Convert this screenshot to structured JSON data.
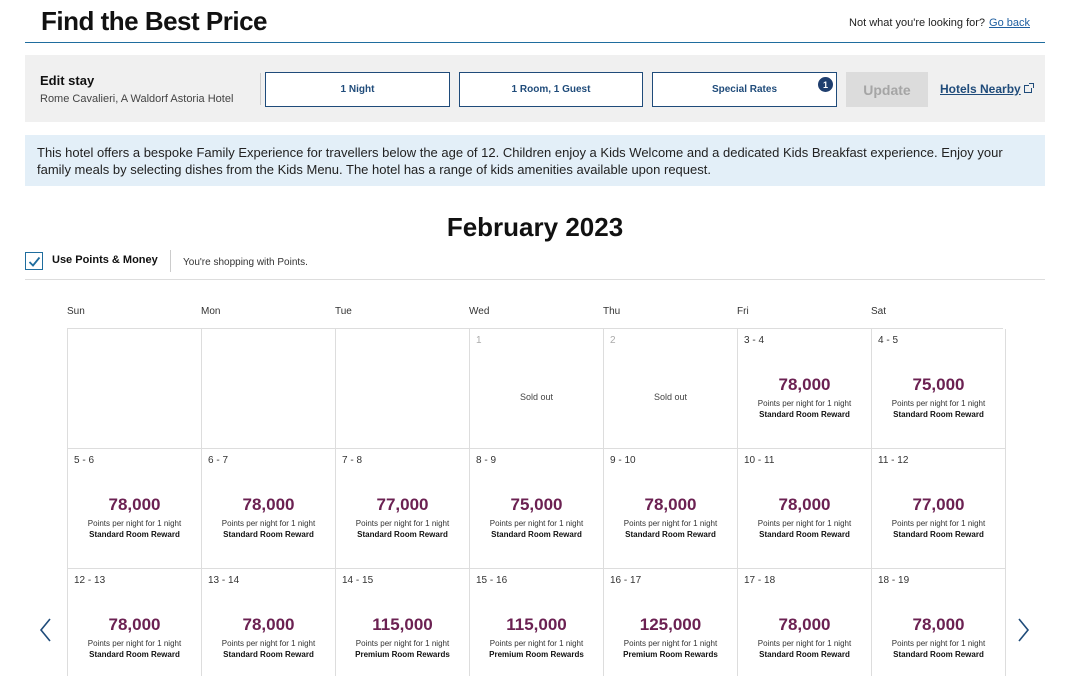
{
  "header": {
    "title": "Find the Best Price",
    "not_looking": "Not what you're looking for?",
    "go_back": "Go back"
  },
  "edit_stay": {
    "label": "Edit stay",
    "hotel": "Rome Cavalieri, A Waldorf Astoria Hotel",
    "nights": "1 Night",
    "rooms": "1 Room, 1 Guest",
    "special_rates": "Special Rates",
    "special_rates_count": "1",
    "update": "Update",
    "nearby": "Hotels Nearby"
  },
  "info": "This hotel offers a bespoke Family Experience for travellers below the age of 12. Children enjoy a Kids Welcome and a dedicated Kids Breakfast experience. Enjoy your family meals by selecting dishes from the Kids Menu. The hotel has a range of kids amenities available upon request.",
  "month": "February 2023",
  "points": {
    "label": "Use Points & Money",
    "checked": true,
    "shopping": "You're shopping with Points."
  },
  "weekdays": [
    "Sun",
    "Mon",
    "Tue",
    "Wed",
    "Thu",
    "Fri",
    "Sat"
  ],
  "colors": {
    "accent": "#1f4b7a",
    "price": "#6b2152",
    "info_bg": "#e3eff8"
  },
  "calendar": [
    [
      {
        "date": "",
        "status": "empty"
      },
      {
        "date": "",
        "status": "empty"
      },
      {
        "date": "",
        "status": "empty"
      },
      {
        "date": "1",
        "status": "soldout",
        "text": "Sold out"
      },
      {
        "date": "2",
        "status": "soldout",
        "text": "Sold out"
      },
      {
        "date": "3 - 4",
        "status": "available",
        "price": "78,000",
        "per_night": "Points per night for 1 night",
        "reward": "Standard Room Reward"
      },
      {
        "date": "4 - 5",
        "status": "available",
        "price": "75,000",
        "per_night": "Points per night for 1 night",
        "reward": "Standard Room Reward"
      }
    ],
    [
      {
        "date": "5 - 6",
        "status": "available",
        "price": "78,000",
        "per_night": "Points per night for 1 night",
        "reward": "Standard Room Reward"
      },
      {
        "date": "6 - 7",
        "status": "available",
        "price": "78,000",
        "per_night": "Points per night for 1 night",
        "reward": "Standard Room Reward"
      },
      {
        "date": "7 - 8",
        "status": "available",
        "price": "77,000",
        "per_night": "Points per night for 1 night",
        "reward": "Standard Room Reward"
      },
      {
        "date": "8 - 9",
        "status": "available",
        "price": "75,000",
        "per_night": "Points per night for 1 night",
        "reward": "Standard Room Reward"
      },
      {
        "date": "9 - 10",
        "status": "available",
        "price": "78,000",
        "per_night": "Points per night for 1 night",
        "reward": "Standard Room Reward"
      },
      {
        "date": "10 - 11",
        "status": "available",
        "price": "78,000",
        "per_night": "Points per night for 1 night",
        "reward": "Standard Room Reward"
      },
      {
        "date": "11 - 12",
        "status": "available",
        "price": "77,000",
        "per_night": "Points per night for 1 night",
        "reward": "Standard Room Reward"
      }
    ],
    [
      {
        "date": "12 - 13",
        "status": "available",
        "price": "78,000",
        "per_night": "Points per night for 1 night",
        "reward": "Standard Room Reward"
      },
      {
        "date": "13 - 14",
        "status": "available",
        "price": "78,000",
        "per_night": "Points per night for 1 night",
        "reward": "Standard Room Reward"
      },
      {
        "date": "14 - 15",
        "status": "available",
        "price": "115,000",
        "per_night": "Points per night for 1 night",
        "reward": "Premium Room Rewards"
      },
      {
        "date": "15 - 16",
        "status": "available",
        "price": "115,000",
        "per_night": "Points per night for 1 night",
        "reward": "Premium Room Rewards"
      },
      {
        "date": "16 - 17",
        "status": "available",
        "price": "125,000",
        "per_night": "Points per night for 1 night",
        "reward": "Premium Room Rewards"
      },
      {
        "date": "17 - 18",
        "status": "available",
        "price": "78,000",
        "per_night": "Points per night for 1 night",
        "reward": "Standard Room Reward"
      },
      {
        "date": "18 - 19",
        "status": "available",
        "price": "78,000",
        "per_night": "Points per night for 1 night",
        "reward": "Standard Room Reward"
      }
    ]
  ]
}
